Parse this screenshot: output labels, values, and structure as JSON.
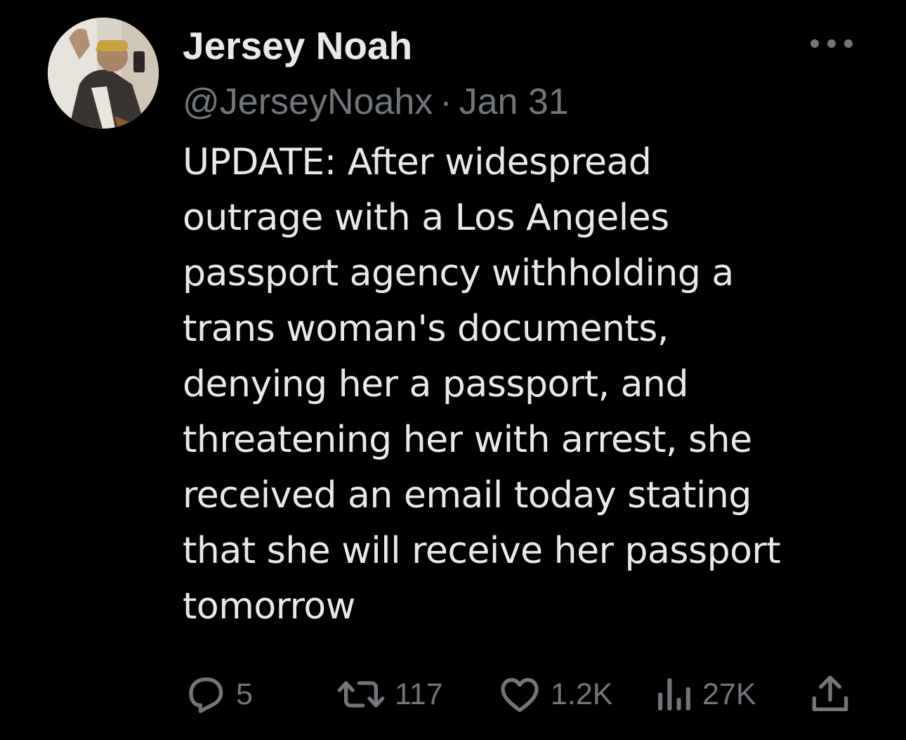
{
  "author": {
    "display_name": "Jersey Noah",
    "handle": "@JerseyNoahx",
    "separator": "·",
    "date": "Jan 31"
  },
  "tweet": {
    "text": "UPDATE: After widespread\noutrage with a Los Angeles\npassport agency withholding a\ntrans woman's documents,\ndenying her a passport, and\nthreatening her with arrest, she\nreceived an email today stating\nthat she will receive her passport\ntomorrow"
  },
  "actions": {
    "reply_count": "5",
    "retweet_count": "117",
    "like_count": "1.2K",
    "views_count": "27K"
  },
  "icons": {
    "more": "more-horizontal-icon",
    "reply": "reply-icon",
    "retweet": "retweet-icon",
    "like": "heart-icon",
    "views": "views-chart-icon",
    "share": "share-icon"
  },
  "colors": {
    "background": "#000000",
    "primary_text": "#e7e9ea",
    "secondary_text": "#71767b"
  }
}
